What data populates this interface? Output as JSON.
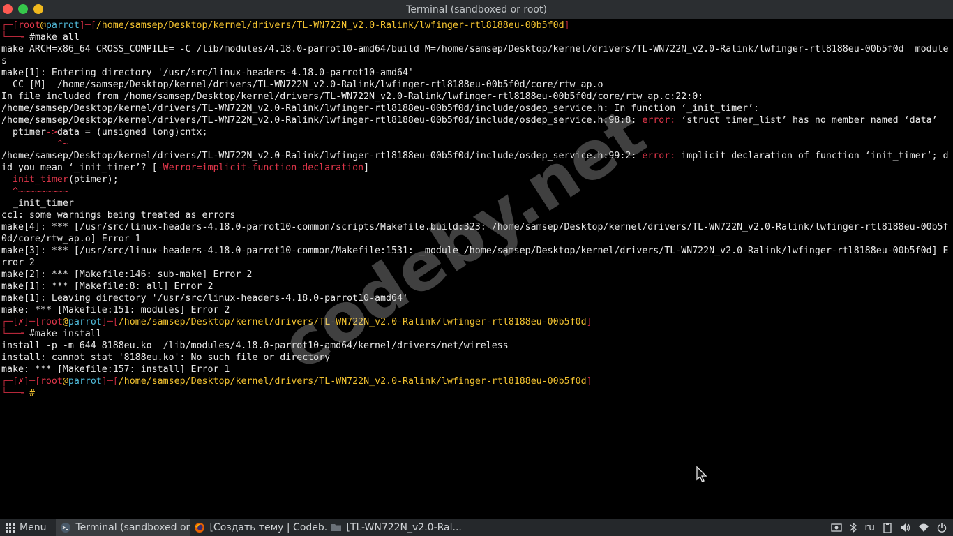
{
  "window": {
    "title": "Terminal (sandboxed or root)"
  },
  "watermark": "codeby.net",
  "terminal": {
    "prompt1": {
      "user": "root",
      "at": "@",
      "host": "parrot",
      "path": "/home/samsep/Desktop/kernel/drivers/TL-WN722N_v2.0-Ralink/lwfinger-rtl8188eu-00b5f0d",
      "command": "#make all"
    },
    "out1": [
      "make ARCH=x86_64 CROSS_COMPILE= -C /lib/modules/4.18.0-parrot10-amd64/build M=/home/samsep/Desktop/kernel/drivers/TL-WN722N_v2.0-Ralink/lwfinger-rtl8188eu-00b5f0d  module",
      "s",
      "make[1]: Entering directory '/usr/src/linux-headers-4.18.0-parrot10-amd64'",
      "  CC [M]  /home/samsep/Desktop/kernel/drivers/TL-WN722N_v2.0-Ralink/lwfinger-rtl8188eu-00b5f0d/core/rtw_ap.o",
      "In file included from /home/samsep/Desktop/kernel/drivers/TL-WN722N_v2.0-Ralink/lwfinger-rtl8188eu-00b5f0d/core/rtw_ap.c:22:0:",
      "/home/samsep/Desktop/kernel/drivers/TL-WN722N_v2.0-Ralink/lwfinger-rtl8188eu-00b5f0d/include/osdep_service.h: In function ‘_init_timer’:"
    ],
    "err1": {
      "prefix": "/home/samsep/Desktop/kernel/drivers/TL-WN722N_v2.0-Ralink/lwfinger-rtl8188eu-00b5f0d/include/osdep_service.h:98:8: ",
      "label": "error:",
      "message": " ‘struct timer_list’ has no member named ‘data’"
    },
    "err1_code": {
      "a": "  ptimer",
      "arrow": "->",
      "b": "data = (unsigned long)cntx;"
    },
    "err1_caret": "          ^~",
    "err2": {
      "prefix": "/home/samsep/Desktop/kernel/drivers/TL-WN722N_v2.0-Ralink/lwfinger-rtl8188eu-00b5f0d/include/osdep_service.h:99:2: ",
      "label": "error:",
      "message": " implicit declaration of function ‘init_timer’; d"
    },
    "err2_cont": {
      "a": "id you mean ‘_init_timer’? [",
      "flag": "-Werror=implicit-function-declaration",
      "b": "]"
    },
    "err2_code": {
      "fn": "  init_timer",
      "rest": "(ptimer);"
    },
    "err2_caret": "  ^~~~~~~~~~",
    "err2_hint": "  _init_timer",
    "out2": [
      "cc1: some warnings being treated as errors",
      "make[4]: *** [/usr/src/linux-headers-4.18.0-parrot10-common/scripts/Makefile.build:323: /home/samsep/Desktop/kernel/drivers/TL-WN722N_v2.0-Ralink/lwfinger-rtl8188eu-00b5f",
      "0d/core/rtw_ap.o] Error 1",
      "make[3]: *** [/usr/src/linux-headers-4.18.0-parrot10-common/Makefile:1531: _module_/home/samsep/Desktop/kernel/drivers/TL-WN722N_v2.0-Ralink/lwfinger-rtl8188eu-00b5f0d] E",
      "rror 2",
      "make[2]: *** [Makefile:146: sub-make] Error 2",
      "make[1]: *** [Makefile:8: all] Error 2",
      "make[1]: Leaving directory '/usr/src/linux-headers-4.18.0-parrot10-amd64'",
      "make: *** [Makefile:151: modules] Error 2"
    ],
    "prompt2": {
      "status": "✗",
      "user": "root",
      "at": "@",
      "host": "parrot",
      "path": "/home/samsep/Desktop/kernel/drivers/TL-WN722N_v2.0-Ralink/lwfinger-rtl8188eu-00b5f0d",
      "command": "#make install"
    },
    "out3": [
      "install -p -m 644 8188eu.ko  /lib/modules/4.18.0-parrot10-amd64/kernel/drivers/net/wireless",
      "install: cannot stat '8188eu.ko': No such file or directory",
      "make: *** [Makefile:157: install] Error 1"
    ],
    "prompt3": {
      "status": "✗",
      "user": "root",
      "at": "@",
      "host": "parrot",
      "path": "/home/samsep/Desktop/kernel/drivers/TL-WN722N_v2.0-Ralink/lwfinger-rtl8188eu-00b5f0d",
      "command": "#"
    }
  },
  "taskbar": {
    "menu_label": "Menu",
    "items": [
      {
        "label": "Terminal (sandboxed or...",
        "icon": "terminal-icon"
      },
      {
        "label": "[Создать тему | Codeb...",
        "icon": "firefox-icon"
      },
      {
        "label": "[TL-WN722N_v2.0-Ral...",
        "icon": "folder-icon"
      }
    ],
    "tray": {
      "lang": "ru"
    }
  },
  "colors": {
    "prompt_bracket": "#e0364a",
    "host": "#4fb8d7",
    "path": "#f2c230",
    "error": "#e0364a"
  }
}
